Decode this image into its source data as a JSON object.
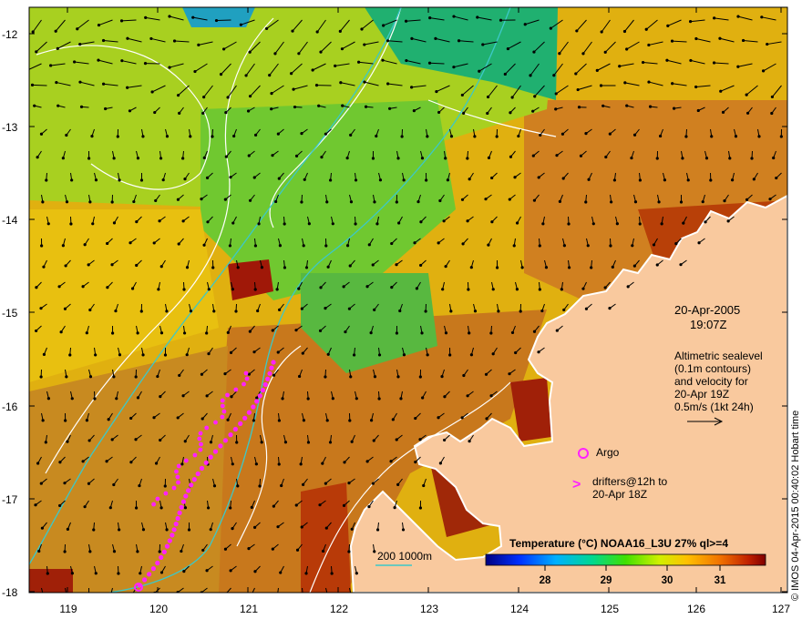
{
  "map": {
    "y_ticks": [
      "-12",
      "-13",
      "-14",
      "-15",
      "-16",
      "-17",
      "-18"
    ],
    "x_ticks": [
      "119",
      "120",
      "121",
      "122",
      "123",
      "124",
      "125",
      "126",
      "127"
    ],
    "lon_range": [
      118.6,
      127.0
    ],
    "lat_range": [
      -11.7,
      -18.0
    ]
  },
  "annotations": {
    "date": "20-Apr-2005",
    "time": "19:07Z",
    "altimetry_lines": [
      "Altimetric sealevel",
      "(0.1m contours)",
      "and velocity for",
      "20-Apr 19Z",
      "0.5m/s (1kt 24h)"
    ],
    "argo_label": "Argo",
    "drifters_lines": [
      "drifters@12h to",
      "20-Apr 18Z"
    ],
    "depth_contour_label": "200  1000m"
  },
  "colorbar": {
    "title": "Temperature (°C) NOAA16_L3U 27% ql>=4",
    "ticks": [
      "28",
      "29",
      "30",
      "31"
    ],
    "tick_values": [
      28,
      29,
      30,
      31
    ],
    "range": [
      27.3,
      31.9
    ]
  },
  "credit": "© IMOS 04-Apr-2015 00:40:02 Hobart time",
  "colors": {
    "land": "#f9c99e",
    "drifter": "#ff22ff",
    "contour_cyan": "#3cc8c8",
    "contour_white": "#ffffff"
  }
}
